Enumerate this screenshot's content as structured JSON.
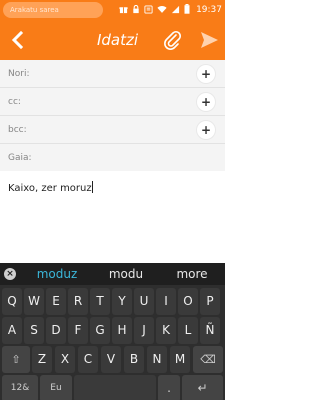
{
  "status_bar": {
    "search_text": "Arakatu sarea",
    "time": "19:37",
    "icons": [
      "gift-icon",
      "lock-icon",
      "notification-icon",
      "wifi-icon",
      "signal-icon",
      "battery-icon"
    ]
  },
  "header": {
    "title": "Idatzi",
    "back_icon": "back-chevron-icon",
    "attach_icon": "paperclip-icon",
    "send_icon": "send-arrow-icon"
  },
  "fields": {
    "to_label": "Nori:",
    "cc_label": "cc:",
    "bcc_label": "bcc:",
    "subject_label": "Gaia:",
    "add_symbol": "+"
  },
  "body": {
    "text": "Kaixo, zer moruz"
  },
  "suggestions": {
    "close_symbol": "×",
    "items": [
      "moduz",
      "modu",
      "more"
    ]
  },
  "keyboard": {
    "row1": [
      "Q",
      "W",
      "E",
      "R",
      "T",
      "Y",
      "U",
      "I",
      "O",
      "P"
    ],
    "row2": [
      "A",
      "S",
      "D",
      "F",
      "G",
      "H",
      "J",
      "K",
      "L",
      "Ñ"
    ],
    "row3": [
      "Z",
      "X",
      "C",
      "V",
      "B",
      "N",
      "M"
    ],
    "shift_symbol": "⇧",
    "backspace_symbol": "⌫",
    "symbols_label": "12&",
    "language_label": "Eu",
    "period_label": ".",
    "enter_symbol": "↵"
  },
  "colors": {
    "accent": "#f97c17",
    "suggestion_active": "#3bb7da",
    "keyboard_bg": "#2e2e2e"
  }
}
